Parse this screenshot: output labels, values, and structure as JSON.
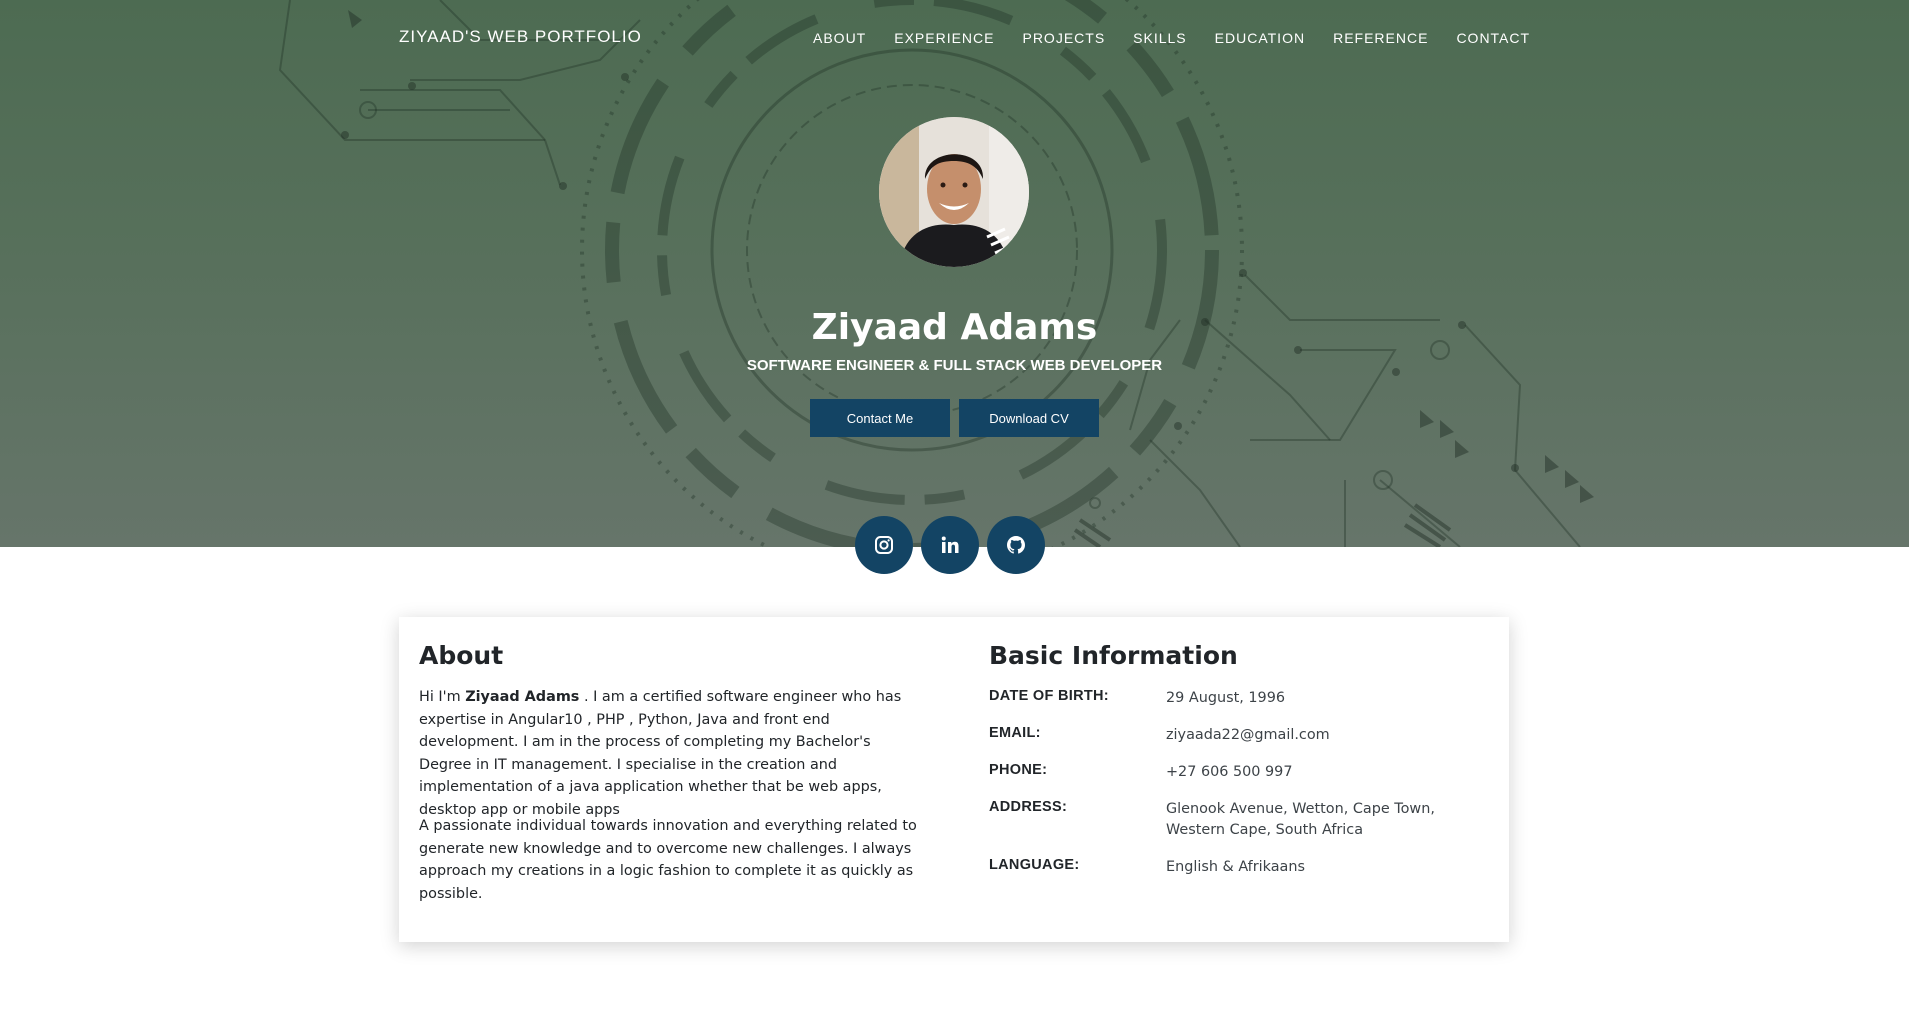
{
  "nav": {
    "brand": "ZIYAAD'S WEB PORTFOLIO",
    "links": [
      "ABOUT",
      "EXPERIENCE",
      "PROJECTS",
      "SKILLS",
      "EDUCATION",
      "REFERENCE",
      "CONTACT"
    ]
  },
  "hero": {
    "name": "Ziyaad Adams",
    "title": "SOFTWARE ENGINEER & FULL STACK WEB DEVELOPER",
    "buttons": {
      "contact": "Contact Me",
      "download": "Download CV"
    },
    "social": [
      "instagram-icon",
      "linkedin-icon",
      "github-icon"
    ]
  },
  "about": {
    "heading": "About",
    "p1_prefix": "Hi I'm ",
    "p1_name": "Ziyaad Adams",
    "p1_rest": " . I am a certified software engineer who has expertise in Angular10 , PHP , Python, Java and front end development. I am in the process of completing my Bachelor's Degree in IT management. I specialise in the creation and implementation of a java application whether that be web apps, desktop app or mobile apps",
    "p2": "A passionate individual towards innovation and everything related to generate new knowledge and to overcome new challenges. I always approach my creations in a logic fashion to complete it as quickly as possible."
  },
  "basic_info": {
    "heading": "Basic Information",
    "rows": [
      {
        "label": "DATE OF BIRTH:",
        "value": "29 August, 1996"
      },
      {
        "label": "EMAIL:",
        "value": "ziyaada22@gmail.com"
      },
      {
        "label": "PHONE:",
        "value": "+27 606 500 997"
      },
      {
        "label": "ADDRESS:",
        "value": "Glenook Avenue, Wetton, Cape Town, Western Cape, South Africa"
      },
      {
        "label": "LANGUAGE:",
        "value": "English & Afrikaans"
      }
    ]
  },
  "colors": {
    "hero_green": "#57705b",
    "button_navy": "#134464",
    "text": "#212529"
  }
}
